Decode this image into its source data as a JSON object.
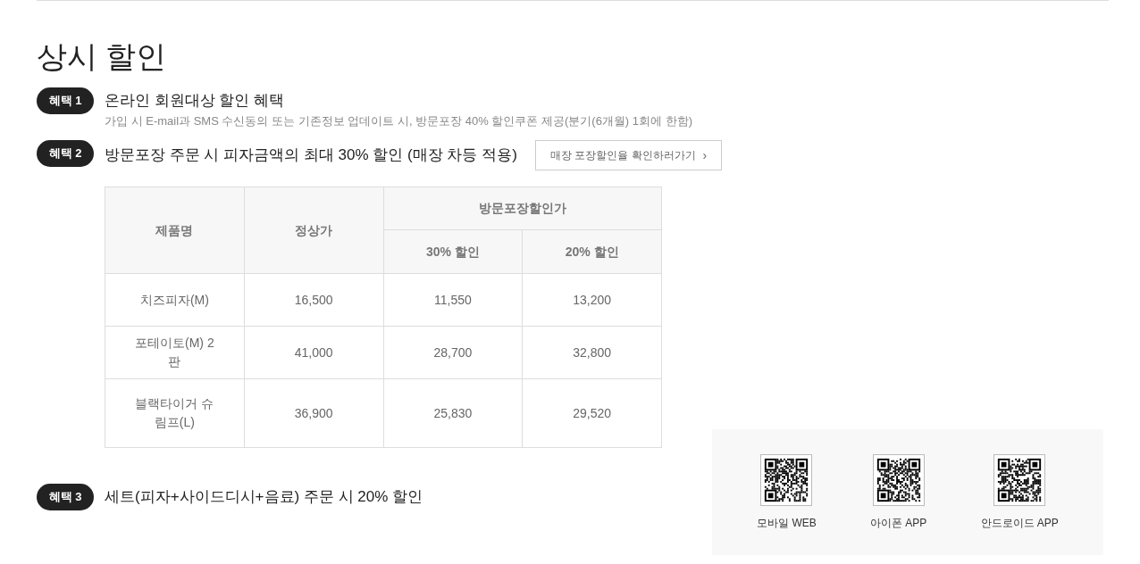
{
  "title": "상시 할인",
  "benefits": [
    {
      "badge": "혜택 1",
      "heading": "온라인 회원대상 할인 혜택",
      "description": "가입 시 E-mail과 SMS 수신동의 또는 기존정보 업데이트 시, 방문포장 40% 할인쿠폰 제공(분기(6개월) 1회에 한함)"
    },
    {
      "badge": "혜택 2",
      "heading": "방문포장 주문 시 피자금액의 최대 30% 할인 (매장 차등 적용)",
      "link": "매장 포장할인율 확인하러가기",
      "link_arrow": "›",
      "table": {
        "columns": [
          "제품명",
          "정상가"
        ],
        "group_header": "방문포장할인가",
        "sub_columns": [
          "30% 할인",
          "20% 할인"
        ],
        "rows": [
          [
            "치즈피자(M)",
            "16,500",
            "11,550",
            "13,200"
          ],
          [
            "포테이토(M) 2판",
            "41,000",
            "28,700",
            "32,800"
          ],
          [
            "블랙타이거 슈림프(L)",
            "36,900",
            "25,830",
            "29,520"
          ]
        ]
      }
    },
    {
      "badge": "혜택 3",
      "heading": "세트(피자+사이드디시+음료) 주문 시 20% 할인"
    }
  ],
  "qr_codes": [
    {
      "label": "모바일 WEB"
    },
    {
      "label": "아이폰 APP"
    },
    {
      "label": "안드로이드 APP"
    }
  ]
}
